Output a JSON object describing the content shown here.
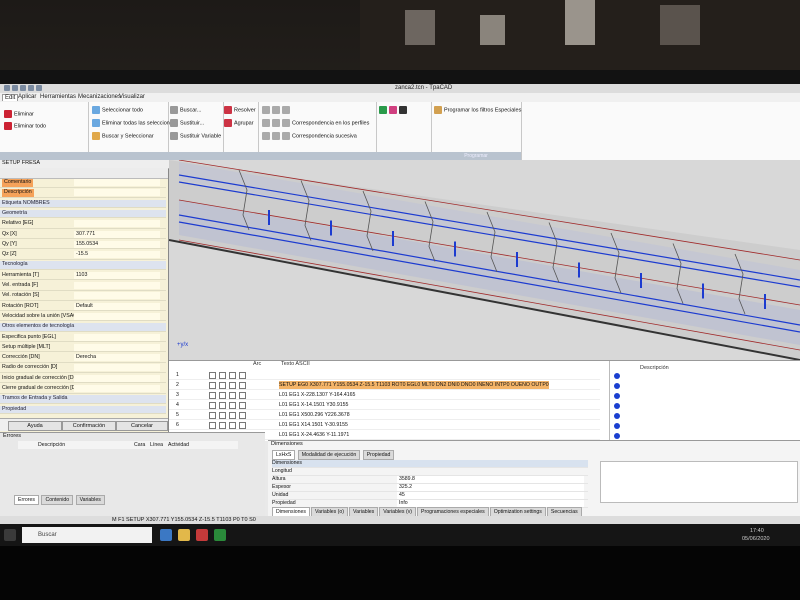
{
  "window": {
    "title": "zanca2.tcn - TpaCAD"
  },
  "menu": [
    "Edit",
    "Aplicar",
    "Herramientas",
    "Mecanizaciones",
    "Visualizar"
  ],
  "ribbon": {
    "left_items": [
      "Eliminar",
      "Eliminar todo"
    ],
    "selection": [
      "Seleccionar todo",
      "Eliminar todas las selecciones",
      "Buscar y Seleccionar"
    ],
    "search": [
      "Buscar...",
      "Sustituir...",
      "Sustituir Variable"
    ],
    "resolve": [
      "Resolver",
      "Agrupar"
    ],
    "perfiles": [
      "Correspondencia en los perfiles",
      "Correspondencia sucesiva"
    ],
    "filtros": "Programar los filtros Especiales",
    "group_filtros": "Programar"
  },
  "left_panel": {
    "title": "SETUP FRESA",
    "rows": [
      {
        "label": "Comentario",
        "value": "",
        "style": "org"
      },
      {
        "label": "Descripción",
        "value": "",
        "style": "org"
      },
      {
        "label": "Etiqueta NOMBRES",
        "value": "",
        "style": "sec"
      },
      {
        "label": "Geometría",
        "value": "",
        "style": "sec"
      },
      {
        "label": "Relativo [EG]",
        "value": "",
        "style": ""
      },
      {
        "label": "Qx [X]",
        "value": "307.771",
        "style": ""
      },
      {
        "label": "Qy [Y]",
        "value": "155.0534",
        "style": ""
      },
      {
        "label": "Qz [Z]",
        "value": "-15.5",
        "style": ""
      },
      {
        "label": "Tecnología",
        "value": "",
        "style": "sec"
      },
      {
        "label": "Herramienta [T]",
        "value": "1103",
        "style": ""
      },
      {
        "label": "Vel. entrada [F]",
        "value": "",
        "style": ""
      },
      {
        "label": "Vel. rotación [S]",
        "value": "",
        "style": ""
      },
      {
        "label": "Rotación [ROT]",
        "value": "Default",
        "style": ""
      },
      {
        "label": "Velocidad sobre la unión [VSAC]",
        "value": "",
        "style": ""
      },
      {
        "label": "Otros elementos de tecnología",
        "value": "",
        "style": "sec"
      },
      {
        "label": "Especifica punto [EGL]",
        "value": "",
        "style": ""
      },
      {
        "label": "Setup múltiple [MLT]",
        "value": "",
        "style": ""
      },
      {
        "label": "Corrección [DN]",
        "value": "Derecha",
        "style": ""
      },
      {
        "label": "Radio de corrección [D]",
        "value": "",
        "style": ""
      },
      {
        "label": "Inicio gradual de corrección [DNI]",
        "value": "",
        "style": ""
      },
      {
        "label": "Cierre gradual de corrección [DNO]",
        "value": "",
        "style": ""
      },
      {
        "label": "Tramos de Entrada y Salida",
        "value": "",
        "style": "sec"
      },
      {
        "label": "Propiedad",
        "value": "",
        "style": "sec"
      }
    ],
    "buttons": [
      "Ayuda",
      "Confirmación",
      "Cancelar"
    ]
  },
  "grid": {
    "headers": {
      "line": "Arc",
      "text": "Texto ASCII",
      "desc": "Descripción"
    },
    "rows": [
      {
        "n": "1",
        "text": "",
        "selected": false
      },
      {
        "n": "2",
        "text": "SETUP EG0 X307.771 Y155.0534 Z-15.5 T1103 ROT0 EGL0 MLT0 DN2 DNI0 DNO0 INENO INTP0 OUENO OUTP0",
        "selected": true
      },
      {
        "n": "3",
        "text": "L01 EG1 X-228.1307 Y-164.4165",
        "selected": false
      },
      {
        "n": "4",
        "text": "L01 EG1 X-14.1501 Y30.9155",
        "selected": false
      },
      {
        "n": "5",
        "text": "L01 EG1 X500.296 Y226.3678",
        "selected": false
      },
      {
        "n": "6",
        "text": "L01 EG1 X14.1501 Y-30.9155",
        "selected": false
      },
      {
        "n": "7",
        "text": "L01 EG1 X-24.4636 Y-11.1971",
        "selected": false
      }
    ]
  },
  "errors": {
    "title": "Errores",
    "columns": [
      "Descripción",
      "Cara",
      "Línea",
      "Actividad"
    ],
    "tabs": [
      "Errores",
      "Contenido",
      "Variables"
    ]
  },
  "dimensions": {
    "title": "Dimensiones",
    "tabs": [
      "LxHxS",
      "Modalidad de ejecución",
      "Propiedad"
    ],
    "section": "Dimensiones",
    "rows": [
      {
        "label": "Longitud",
        "value": ""
      },
      {
        "label": "Altura",
        "value": "3589.8"
      },
      {
        "label": "Espesor",
        "value": "325.2"
      },
      {
        "label": "Unidad",
        "value": "45"
      },
      {
        "label": "Propiedad",
        "value": "Info"
      }
    ],
    "bottom_tabs": [
      "Dimensiones",
      "Variables (o)",
      "Variables",
      "Variables (v)",
      "Programaciones especiales",
      "Optimization settings",
      "Secuencias"
    ]
  },
  "status": {
    "text": "M F1 SETUP X307.771 Y155.0534 Z-15.5 T1103 P0 T0 S0"
  },
  "taskbar": {
    "search": "Buscar",
    "time": "17:40",
    "date": "05/06/2020"
  }
}
